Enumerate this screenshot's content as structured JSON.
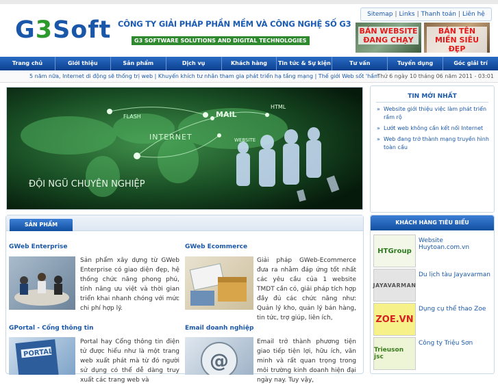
{
  "header": {
    "logo_g": "G",
    "logo_three": "3",
    "logo_soft": "Soft",
    "company_name": "CÔNG TY GIẢI PHÁP PHẦN MỀM VÀ CÔNG NGHỆ SỐ G3",
    "company_name_en": "G3 SOFTWARE SOLUTIONS AND DIGITAL TECHNOLOGIES",
    "toplinks": [
      "Sitemap",
      "Links",
      "Thanh toán",
      "Liên hệ"
    ],
    "banner1": "BÁN WEBSITE ĐANG CHẠY",
    "banner2": "BÁN TÊN MIỀN SIÊU ĐẸP"
  },
  "nav": [
    "Trang chủ",
    "Giới thiệu",
    "Sản phẩm",
    "Dịch vụ",
    "Khách hàng",
    "Tin tức & Sự kiện",
    "Tư vấn",
    "Tuyển dụng",
    "Góc giải trí"
  ],
  "ticker": {
    "news": "5 năm nữa, Internet di động sẽ thống trị web | Khuyến khích tư nhân tham gia phát triển hạ tầng mạng | Thế giới Web sốt 'hầm",
    "date": "Thứ 6 ngày 10 tháng 06 năm 2011 - 03:01"
  },
  "hero": {
    "caption": "ĐỘI NGŨ CHUYÊN NGHIỆP",
    "labels": [
      "FLASH",
      "MAIL",
      "HTML",
      "INTERNET",
      "WEBSITE"
    ]
  },
  "products": {
    "tab": "SẢN PHẨM",
    "items": [
      {
        "title": "GWeb Enterprise",
        "desc": "Sản phẩm xây dựng từ GWeb Enterprise có giao diện đẹp, hệ thống chức năng phong phú, tính năng ưu việt và thời gian triển khai nhanh chóng với mức chi phí hợp lý."
      },
      {
        "title": "GWeb Ecommerce",
        "desc": "Giải pháp GWeb-Ecommerce đưa ra nhằm đáp ứng tốt nhất các yêu cầu của 1 website TMDT cần có, giải pháp tích hợp đầy đủ các chức năng như: Quản lý kho, quản lý bán hàng, tin tức, trợ giúp, liên ích,"
      },
      {
        "title": "GPortal - Cổng thông tin",
        "desc": "Portal hay Cổng thông tin điện tử được hiểu như là một trang web xuất phát mà từ đó người sử dụng có thể dễ dàng truy xuất các trang web và"
      },
      {
        "title": "Email doanh nghiệp",
        "desc": "Email trở thành phương tiện giao tiếp tiện lợi, hữu ích, văn minh và rất quan trọng trong môi trường kinh doanh hiện đại ngày nay. Tuy vậy,"
      }
    ]
  },
  "news_sidebar": {
    "title": "TIN MỚI NHẤT",
    "items": [
      "Website giới thiệu việc làm phát triển rầm rộ",
      "Lướt web không cần kết nối Internet",
      "Web đang trở thành mạng truyền hình toàn cầu"
    ]
  },
  "customers": {
    "title": "KHÁCH HÀNG TIÊU BIỂU",
    "items": [
      {
        "logo": "HTGroup",
        "name": "Website Huytoan.com.vn"
      },
      {
        "logo": "JAYAVARMAN",
        "name": "Du lịch tàu Jayavarman"
      },
      {
        "logo": "ZOE.VN",
        "name": "Dụng cụ thể thao Zoe"
      },
      {
        "logo": "Trieuson jsc",
        "name": "Công ty Triệu Sơn"
      }
    ]
  },
  "colors": {
    "brand_blue": "#1a57a8",
    "brand_green": "#2d9a2d",
    "nav_blue": "#0b3f8f",
    "banner_red": "#e31b1b"
  }
}
